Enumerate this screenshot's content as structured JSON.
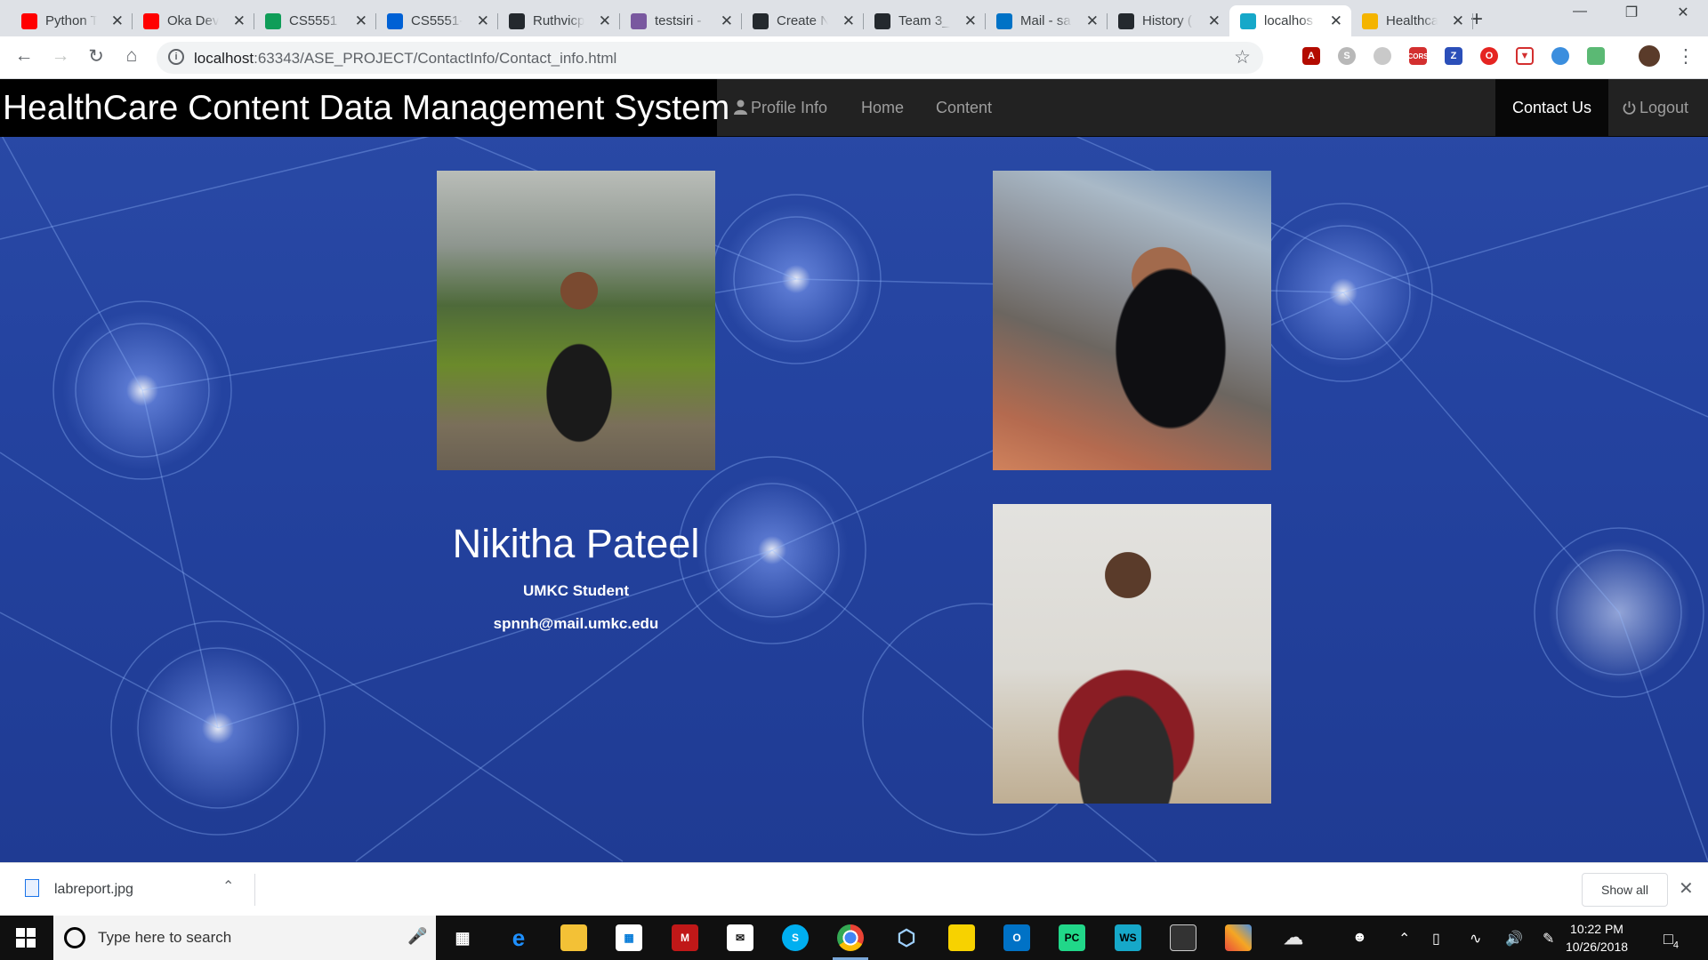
{
  "browser": {
    "tabs": [
      {
        "title": "Python T",
        "favicon": "youtube-icon",
        "color": "#ff0000"
      },
      {
        "title": "Oka Dev",
        "favicon": "youtube-icon",
        "color": "#ff0000"
      },
      {
        "title": "CS5551",
        "favicon": "sheets-icon",
        "color": "#0f9d58"
      },
      {
        "title": "CS5551-",
        "favicon": "box-icon",
        "color": "#0061d5"
      },
      {
        "title": "Ruthvicp",
        "favicon": "github-icon",
        "color": "#24292e"
      },
      {
        "title": "testsiri -",
        "favicon": "heroku-icon",
        "color": "#79589f"
      },
      {
        "title": "Create N",
        "favicon": "github-icon",
        "color": "#24292e"
      },
      {
        "title": "Team 3_",
        "favicon": "github-icon",
        "color": "#24292e"
      },
      {
        "title": "Mail - sa",
        "favicon": "outlook-icon",
        "color": "#0072c6"
      },
      {
        "title": "History (",
        "favicon": "github-icon",
        "color": "#24292e"
      },
      {
        "title": "localhos",
        "favicon": "webstorm-icon",
        "color": "#16a8c9"
      },
      {
        "title": "Healthca",
        "favicon": "hand-icon",
        "color": "#f4b400"
      }
    ],
    "url_host": "localhost",
    "url_rest": ":63343/ASE_PROJECT/ContactInfo/Contact_info.html"
  },
  "nav": {
    "brand": "HealthCare Content Data Management System",
    "profile": "Profile Info",
    "home": "Home",
    "content": "Content",
    "contact": "Contact Us",
    "logout": "Logout"
  },
  "profile": {
    "name": "Nikitha Pateel",
    "role": "UMKC Student",
    "email": "spnnh@mail.umkc.edu"
  },
  "downloads": {
    "file": "labreport.jpg",
    "show_all": "Show all"
  },
  "taskbar": {
    "search_placeholder": "Type here to search",
    "time": "10:22 PM",
    "date": "10/26/2018",
    "notifications": "4"
  }
}
